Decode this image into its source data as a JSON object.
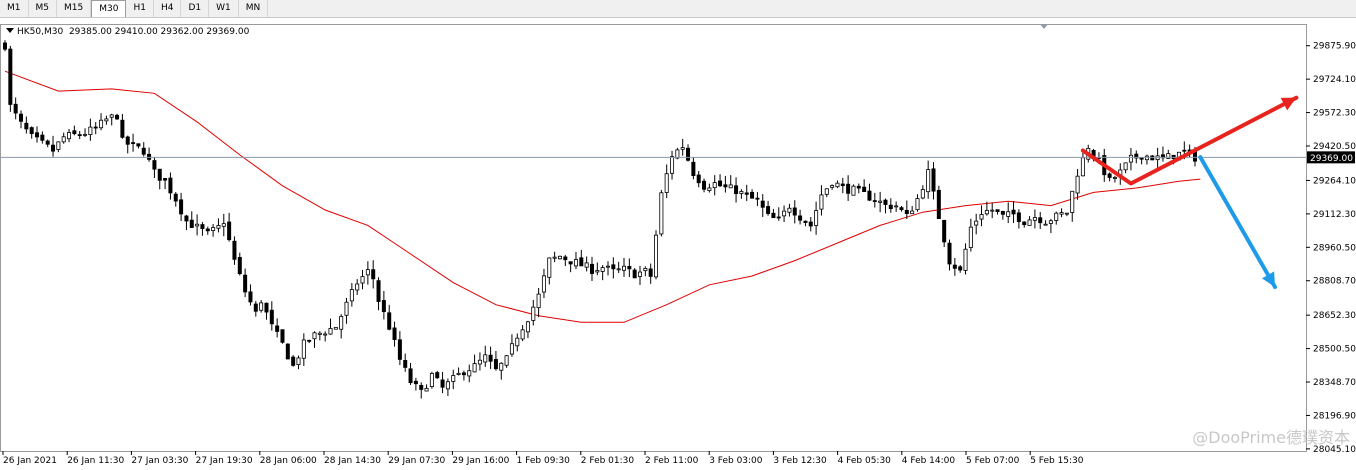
{
  "toolbar": {
    "timeframes": [
      {
        "label": "M1",
        "active": false
      },
      {
        "label": "M5",
        "active": false
      },
      {
        "label": "M15",
        "active": false
      },
      {
        "label": "M30",
        "active": true
      },
      {
        "label": "H1",
        "active": false
      },
      {
        "label": "H4",
        "active": false
      },
      {
        "label": "D1",
        "active": false
      },
      {
        "label": "W1",
        "active": false
      },
      {
        "label": "MN",
        "active": false
      }
    ]
  },
  "chart_info": {
    "symbol_tf": "HK50,M30",
    "ohlc": "29385.00 29410.00 29362.00 29369.00"
  },
  "watermark": "@DooPrime德璞资本",
  "colors": {
    "candle": "#000000",
    "moving_average": "#e00000",
    "current_price_line": "#8c9aa8",
    "up_arrow": "#e8231e",
    "down_arrow": "#1e9be6",
    "price_tag_bg": "#000000",
    "price_tag_text": "#ffffff"
  },
  "chart_data": {
    "type": "candlestick",
    "symbol": "HK50",
    "timeframe": "M30",
    "current_price": 29369.0,
    "ylim": [
      28040,
      29970
    ],
    "y_ticks": [
      "29875.90",
      "29724.10",
      "29572.30",
      "29420.50",
      "29264.10",
      "29112.30",
      "28960.50",
      "28808.70",
      "28652.30",
      "28500.50",
      "28348.70",
      "28196.90",
      "28045.10"
    ],
    "current_price_label": "29369.00",
    "x_ticks": [
      "26 Jan 2021",
      "26 Jan 11:30",
      "27 Jan 03:30",
      "27 Jan 19:30",
      "28 Jan 06:00",
      "28 Jan 14:30",
      "29 Jan 07:30",
      "29 Jan 16:00",
      "1 Feb 09:30",
      "2 Feb 01:30",
      "2 Feb 11:00",
      "3 Feb 03:00",
      "3 Feb 12:30",
      "4 Feb 05:30",
      "4 Feb 14:00",
      "5 Feb 07:00",
      "5 Feb 15:30"
    ],
    "close_path": [
      [
        0,
        29880
      ],
      [
        1,
        29600
      ],
      [
        3,
        29520
      ],
      [
        5,
        29460
      ],
      [
        7,
        29430
      ],
      [
        9,
        29400
      ],
      [
        11,
        29460
      ],
      [
        13,
        29470
      ],
      [
        15,
        29480
      ],
      [
        17,
        29500
      ],
      [
        19,
        29540
      ],
      [
        21,
        29560
      ],
      [
        22,
        29440
      ],
      [
        24,
        29420
      ],
      [
        26,
        29400
      ],
      [
        28,
        29300
      ],
      [
        30,
        29260
      ],
      [
        32,
        29180
      ],
      [
        34,
        29080
      ],
      [
        36,
        29050
      ],
      [
        38,
        29020
      ],
      [
        40,
        29050
      ],
      [
        41,
        29080
      ],
      [
        43,
        28900
      ],
      [
        45,
        28760
      ],
      [
        47,
        28660
      ],
      [
        48,
        28720
      ],
      [
        50,
        28600
      ],
      [
        52,
        28520
      ],
      [
        54,
        28420
      ],
      [
        56,
        28520
      ],
      [
        58,
        28560
      ],
      [
        60,
        28580
      ],
      [
        62,
        28600
      ],
      [
        64,
        28700
      ],
      [
        66,
        28800
      ],
      [
        68,
        28850
      ],
      [
        69,
        28820
      ],
      [
        70,
        28720
      ],
      [
        72,
        28600
      ],
      [
        74,
        28450
      ],
      [
        76,
        28350
      ],
      [
        78,
        28300
      ],
      [
        80,
        28380
      ],
      [
        82,
        28320
      ],
      [
        84,
        28360
      ],
      [
        86,
        28400
      ],
      [
        88,
        28420
      ],
      [
        90,
        28460
      ],
      [
        92,
        28400
      ],
      [
        94,
        28450
      ],
      [
        96,
        28560
      ],
      [
        98,
        28640
      ],
      [
        100,
        28740
      ],
      [
        102,
        28900
      ],
      [
        104,
        28920
      ],
      [
        106,
        28900
      ],
      [
        108,
        28880
      ],
      [
        110,
        28860
      ],
      [
        112,
        28870
      ],
      [
        114,
        28850
      ],
      [
        116,
        28860
      ],
      [
        118,
        28840
      ],
      [
        120,
        28850
      ],
      [
        121,
        28830
      ],
      [
        123,
        29200
      ],
      [
        125,
        29380
      ],
      [
        127,
        29420
      ],
      [
        129,
        29300
      ],
      [
        131,
        29240
      ],
      [
        133,
        29250
      ],
      [
        135,
        29230
      ],
      [
        137,
        29220
      ],
      [
        139,
        29190
      ],
      [
        141,
        29170
      ],
      [
        143,
        29100
      ],
      [
        145,
        29080
      ],
      [
        147,
        29150
      ],
      [
        149,
        29100
      ],
      [
        151,
        29060
      ],
      [
        153,
        29200
      ],
      [
        155,
        29260
      ],
      [
        157,
        29230
      ],
      [
        159,
        29220
      ],
      [
        161,
        29200
      ],
      [
        163,
        29180
      ],
      [
        165,
        29150
      ],
      [
        167,
        29150
      ],
      [
        169,
        29100
      ],
      [
        171,
        29180
      ],
      [
        173,
        29300
      ],
      [
        175,
        29100
      ],
      [
        177,
        28900
      ],
      [
        179,
        28850
      ],
      [
        181,
        29050
      ],
      [
        183,
        29120
      ],
      [
        185,
        29130
      ],
      [
        187,
        29100
      ],
      [
        189,
        29110
      ],
      [
        191,
        29080
      ],
      [
        193,
        29100
      ],
      [
        195,
        29080
      ],
      [
        197,
        29100
      ],
      [
        199,
        29120
      ],
      [
        201,
        29300
      ],
      [
        203,
        29420
      ],
      [
        205,
        29350
      ],
      [
        207,
        29260
      ],
      [
        209,
        29300
      ],
      [
        211,
        29360
      ],
      [
        213,
        29380
      ],
      [
        215,
        29370
      ],
      [
        217,
        29360
      ],
      [
        219,
        29380
      ],
      [
        221,
        29390
      ],
      [
        223,
        29369
      ]
    ],
    "moving_average_path": [
      [
        0,
        29760
      ],
      [
        10,
        29670
      ],
      [
        20,
        29680
      ],
      [
        28,
        29660
      ],
      [
        36,
        29530
      ],
      [
        44,
        29380
      ],
      [
        52,
        29240
      ],
      [
        60,
        29130
      ],
      [
        68,
        29060
      ],
      [
        76,
        28930
      ],
      [
        84,
        28800
      ],
      [
        92,
        28700
      ],
      [
        100,
        28650
      ],
      [
        108,
        28620
      ],
      [
        116,
        28620
      ],
      [
        124,
        28700
      ],
      [
        132,
        28790
      ],
      [
        140,
        28830
      ],
      [
        148,
        28900
      ],
      [
        156,
        28980
      ],
      [
        164,
        29060
      ],
      [
        172,
        29120
      ],
      [
        180,
        29150
      ],
      [
        188,
        29170
      ],
      [
        196,
        29150
      ],
      [
        204,
        29210
      ],
      [
        212,
        29230
      ],
      [
        220,
        29260
      ],
      [
        224,
        29270
      ]
    ],
    "arrows": [
      {
        "name": "red-zigzag",
        "color": "#e8231e",
        "points": [
          [
            202,
            29400
          ],
          [
            211,
            29250
          ],
          [
            242,
            29640
          ]
        ]
      },
      {
        "name": "blue-down",
        "color": "#1e9be6",
        "points": [
          [
            224,
            29370
          ],
          [
            238,
            28780
          ]
        ]
      }
    ]
  }
}
